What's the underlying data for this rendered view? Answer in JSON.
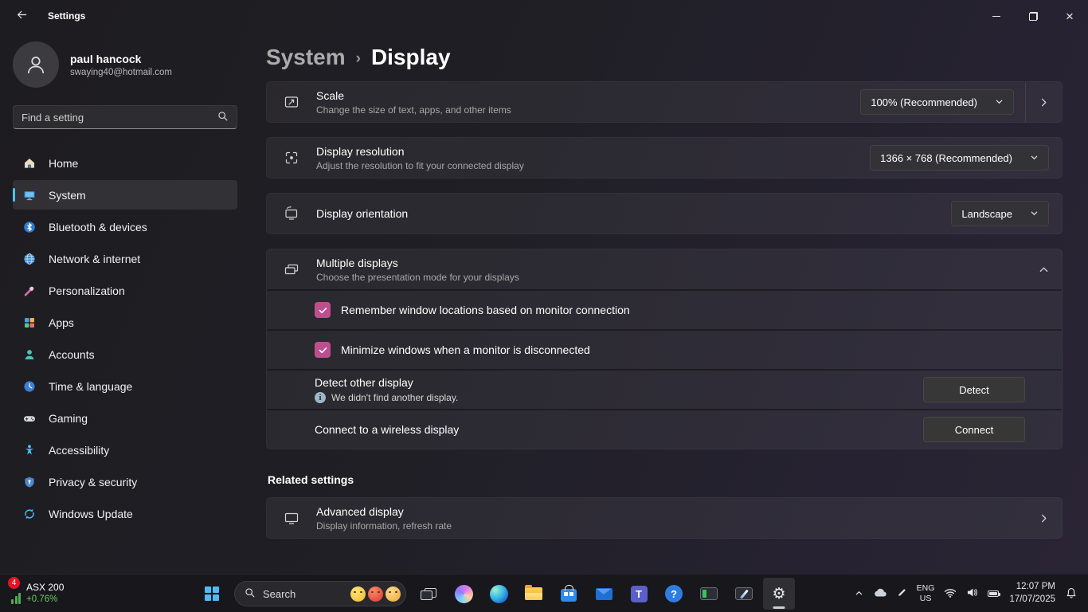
{
  "titlebar": {
    "title": "Settings"
  },
  "colors": {
    "accent": "#4cc2ff",
    "checkbox_accent": "#bd4f8e",
    "positive_green": "#6ccb5f",
    "badge_red": "#e81123"
  },
  "icons": {
    "gear": "⚙",
    "help": "?",
    "teams": "T",
    "info": "i"
  },
  "sidebar": {
    "user": {
      "name": "paul hancock",
      "email": "swaying40@hotmail.com"
    },
    "search": {
      "placeholder": "Find a setting"
    },
    "items": [
      {
        "label": "Home",
        "icon": "home"
      },
      {
        "label": "System",
        "icon": "system",
        "selected": true
      },
      {
        "label": "Bluetooth & devices",
        "icon": "bluetooth"
      },
      {
        "label": "Network & internet",
        "icon": "network"
      },
      {
        "label": "Personalization",
        "icon": "personalization"
      },
      {
        "label": "Apps",
        "icon": "apps"
      },
      {
        "label": "Accounts",
        "icon": "accounts"
      },
      {
        "label": "Time & language",
        "icon": "time-language"
      },
      {
        "label": "Gaming",
        "icon": "gaming"
      },
      {
        "label": "Accessibility",
        "icon": "accessibility"
      },
      {
        "label": "Privacy & security",
        "icon": "privacy-security"
      },
      {
        "label": "Windows Update",
        "icon": "windows-update"
      }
    ]
  },
  "main": {
    "breadcrumb": {
      "root": "System",
      "sep": "›",
      "page": "Display"
    },
    "scale": {
      "title": "Scale",
      "subtitle": "Change the size of text, apps, and other items",
      "value": "100% (Recommended)"
    },
    "resolution": {
      "title": "Display resolution",
      "subtitle": "Adjust the resolution to fit your connected display",
      "value": "1366 × 768 (Recommended)"
    },
    "orientation": {
      "title": "Display orientation",
      "value": "Landscape"
    },
    "multiple_displays": {
      "title": "Multiple displays",
      "subtitle": "Choose the presentation mode for your displays",
      "checkbox1": "Remember window locations based on monitor connection",
      "checkbox2": "Minimize windows when a monitor is disconnected",
      "checkbox1_checked": true,
      "checkbox2_checked": true,
      "detect_title": "Detect other display",
      "detect_status": "We didn't find another display.",
      "detect_button": "Detect",
      "connect_title": "Connect to a wireless display",
      "connect_button": "Connect"
    },
    "related": {
      "heading": "Related settings",
      "advanced_title": "Advanced display",
      "advanced_subtitle": "Display information, refresh rate"
    }
  },
  "taskbar": {
    "widget": {
      "badge": "4",
      "label": "ASX 200",
      "change": "+0.76%"
    },
    "search": {
      "label": "Search"
    },
    "tray": {
      "lang1": "ENG",
      "lang2": "US",
      "time": "12:07 PM",
      "date": "17/07/2025"
    }
  }
}
